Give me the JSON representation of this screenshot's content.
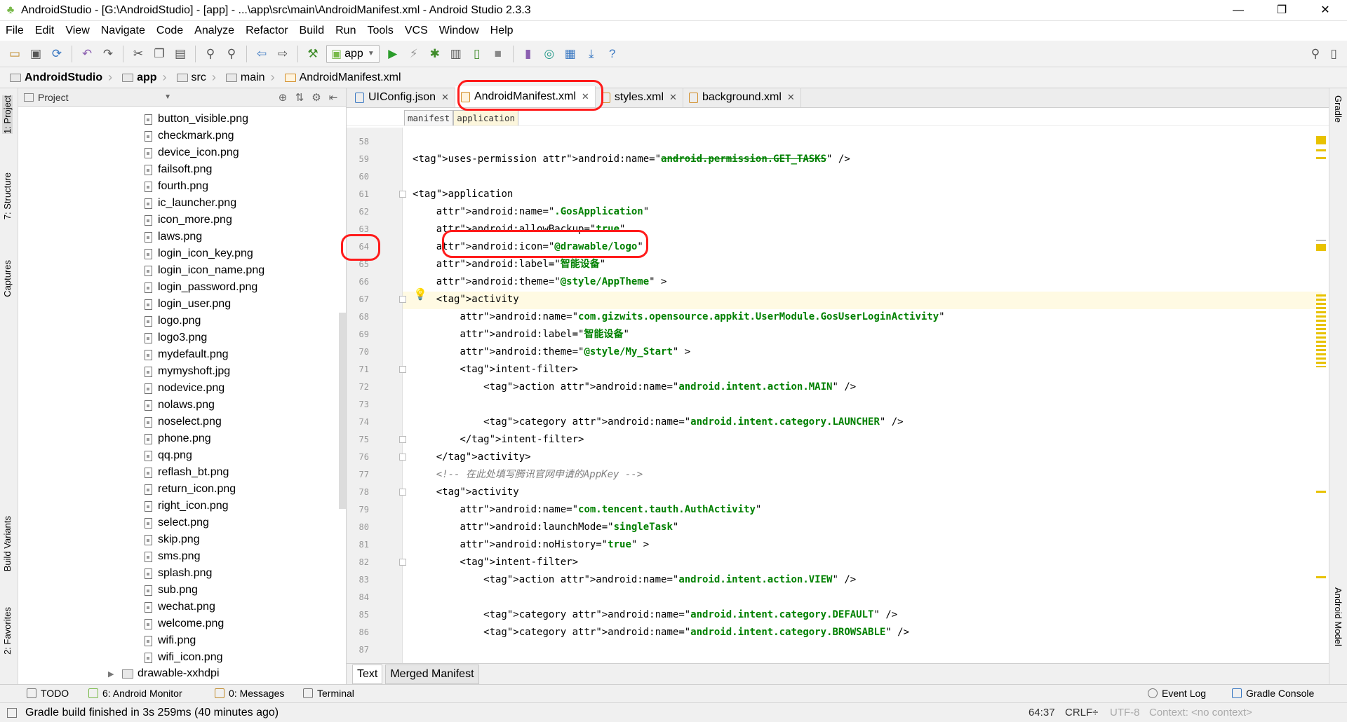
{
  "window": {
    "title": "AndroidStudio - [G:\\AndroidStudio] - [app] - ...\\app\\src\\main\\AndroidManifest.xml - Android Studio 2.3.3",
    "controls": [
      "—",
      "❐",
      "✕"
    ]
  },
  "menubar": [
    "File",
    "Edit",
    "View",
    "Navigate",
    "Code",
    "Analyze",
    "Refactor",
    "Build",
    "Run",
    "Tools",
    "VCS",
    "Window",
    "Help"
  ],
  "toolbar": {
    "run_config": "app"
  },
  "breadcrumb": [
    "AndroidStudio",
    "app",
    "src",
    "main",
    "AndroidManifest.xml"
  ],
  "left_tool_tabs": [
    "1: Project",
    "7: Structure",
    "Captures",
    "Build Variants",
    "2: Favorites"
  ],
  "right_tool_tabs": [
    "Gradle",
    "Android Model"
  ],
  "project_panel": {
    "view_selector": "Project",
    "files": [
      "button_visible.png",
      "checkmark.png",
      "device_icon.png",
      "failsoft.png",
      "fourth.png",
      "ic_launcher.png",
      "icon_more.png",
      "laws.png",
      "login_icon_key.png",
      "login_icon_name.png",
      "login_password.png",
      "login_user.png",
      "logo.png",
      "logo3.png",
      "mydefault.png",
      "mymyshoft.jpg",
      "nodevice.png",
      "nolaws.png",
      "noselect.png",
      "phone.png",
      "qq.png",
      "reflash_bt.png",
      "return_icon.png",
      "right_icon.png",
      "select.png",
      "skip.png",
      "sms.png",
      "splash.png",
      "sub.png",
      "wechat.png",
      "welcome.png",
      "wifi.png",
      "wifi_icon.png"
    ],
    "folder": "drawable-xxhdpi"
  },
  "editor": {
    "tabs": [
      {
        "label": "UIConfig.json",
        "active": false
      },
      {
        "label": "AndroidManifest.xml",
        "active": true
      },
      {
        "label": "styles.xml",
        "active": false
      },
      {
        "label": "background.xml",
        "active": false
      }
    ],
    "xml_breadcrumbs": [
      "manifest",
      "application"
    ],
    "first_line_number": 58,
    "lines": [
      "",
      "<uses-permission android:name=\"android.permission.GET_TASKS\" />",
      "",
      "<application",
      "    android:name=\".GosApplication\"",
      "    android:allowBackup=\"true\"",
      "    android:icon=\"@drawable/logo\"",
      "    android:label=\"智能设备\"",
      "    android:theme=\"@style/AppTheme\" >",
      "    <activity",
      "        android:name=\"com.gizwits.opensource.appkit.UserModule.GosUserLoginActivity\"",
      "        android:label=\"智能设备\"",
      "        android:theme=\"@style/My_Start\" >",
      "        <intent-filter>",
      "            <action android:name=\"android.intent.action.MAIN\" />",
      "",
      "            <category android:name=\"android.intent.category.LAUNCHER\" />",
      "        </intent-filter>",
      "    </activity>",
      "    <!-- 在此处填写腾讯官网申请的AppKey -->",
      "    <activity",
      "        android:name=\"com.tencent.tauth.AuthActivity\"",
      "        android:launchMode=\"singleTask\"",
      "        android:noHistory=\"true\" >",
      "        <intent-filter>",
      "            <action android:name=\"android.intent.action.VIEW\" />",
      "",
      "            <category android:name=\"android.intent.category.DEFAULT\" />",
      "            <category android:name=\"android.intent.category.BROWSABLE\" />",
      ""
    ],
    "bottom_tabs": [
      "Text",
      "Merged Manifest"
    ]
  },
  "tool_windows": [
    "TODO",
    "6: Android Monitor",
    "0: Messages",
    "Terminal",
    "Event Log",
    "Gradle Console"
  ],
  "status": {
    "message": "Gradle build finished in 3s 259ms (40 minutes ago)",
    "position": "64:37",
    "line_separator": "CRLF÷",
    "encoding": "UTF-8",
    "context": "Context: <no context>"
  }
}
